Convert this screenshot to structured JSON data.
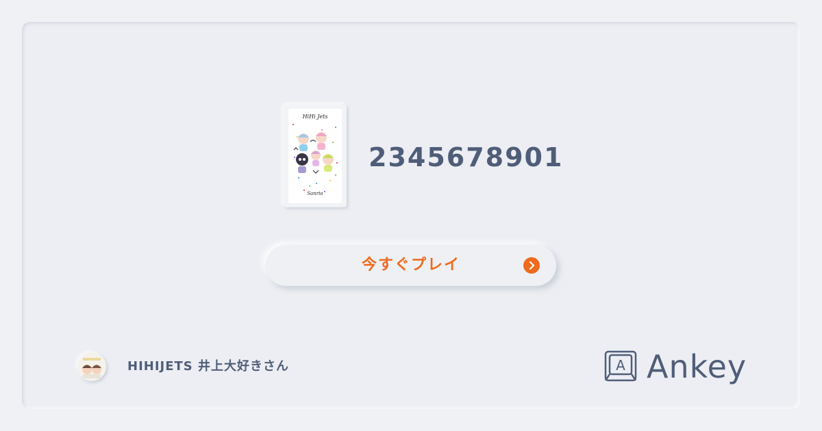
{
  "main": {
    "code": "2345678901",
    "thumbnail": {
      "title_text": "HiHi Jets",
      "footer_text": "Sanrio"
    },
    "play_button": {
      "label": "今すぐプレイ",
      "icon": "chevron-right-icon"
    }
  },
  "footer": {
    "username": "HIHIJETS 井上大好きさん",
    "brand_name": "Ankey",
    "brand_icon_letter": "A"
  },
  "colors": {
    "accent": "#ef6a1d",
    "text": "#4f5d78",
    "background": "#eceef3"
  }
}
